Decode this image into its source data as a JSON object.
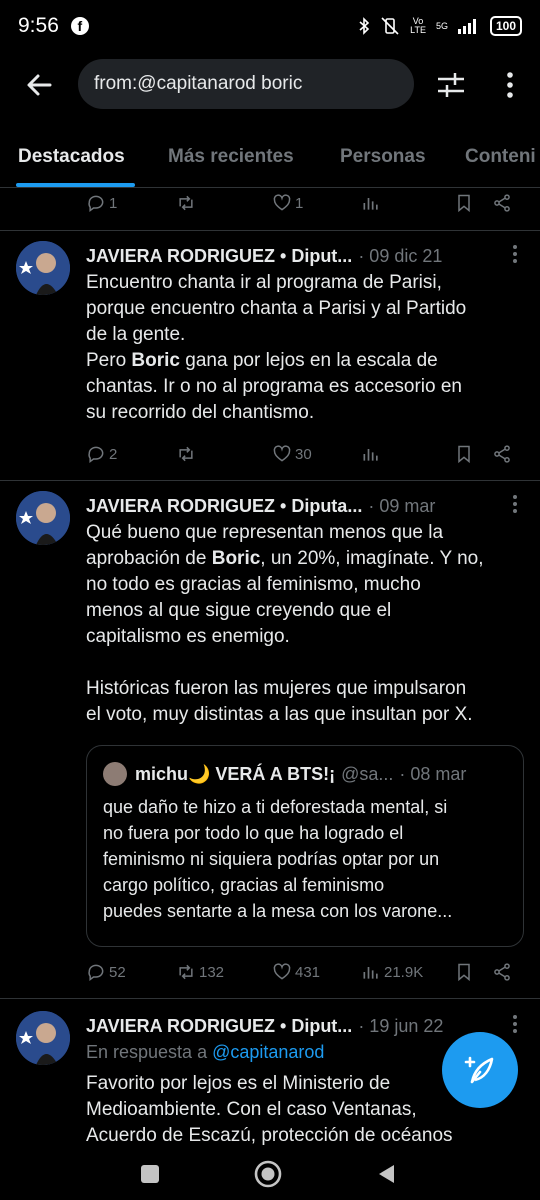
{
  "status_bar": {
    "time": "9:56",
    "network_top": "Vo",
    "network_bottom": "LTE",
    "signal_label": "5G",
    "battery": "100"
  },
  "search": {
    "query": "from:@capitanarod boric"
  },
  "tabs": [
    {
      "label": "Destacados",
      "active": true
    },
    {
      "label": "Más recientes",
      "active": false
    },
    {
      "label": "Personas",
      "active": false
    },
    {
      "label": "Conteni",
      "active": false
    }
  ],
  "top_actions": {
    "replies": "1",
    "retweets": "",
    "likes": "1"
  },
  "tweets": [
    {
      "author": "JAVIERA RODRIGUEZ • Diput...",
      "date": "· 09 dic 21",
      "body_1": "Encuentro chanta ir al programa de Parisi,\nporque encuentro chanta a Parisi y al Partido\nde la gente.\nPero ",
      "body_bold": "Boric",
      "body_2": " gana por lejos en la escala de\nchantas. Ir o no al programa es accesorio en\nsu recorrido del chantismo.",
      "replies": "2",
      "retweets": "",
      "likes": "30"
    },
    {
      "author": "JAVIERA RODRIGUEZ • Diputa...",
      "date": "· 09 mar",
      "body_1": "Qué bueno que representan menos que la\naprobación de ",
      "body_bold": "Boric",
      "body_2": ", un 20%, imagínate. Y no,\nno todo es gracias al feminismo, mucho\nmenos al que sigue creyendo que el\ncapitalismo es enemigo.\n\nHistóricas fueron las mujeres que impulsaron\nel voto, muy distintas a las que insultan por X.",
      "quote": {
        "author": "michu🌙 VERÁ A BTS!¡",
        "handle": "@sa...",
        "date": "· 08 mar",
        "body": "que daño te hizo a ti deforestada mental, si\nno fuera por todo lo que ha logrado el\nfeminismo ni siquiera podrías optar por un\ncargo político, gracias al feminismo\npuedes sentarte a la mesa con los varone..."
      },
      "replies": "52",
      "retweets": "132",
      "likes": "431",
      "views": "21.9K"
    },
    {
      "author": "JAVIERA RODRIGUEZ • Diput...",
      "date": "· 19 jun 22",
      "reply_prefix": "En respuesta a ",
      "reply_handle": "@capitanarod",
      "body_1": "Favorito por lejos es el Ministerio de\nMedioambiente. Con el caso Ventanas,\nAcuerdo de Escazú, protección de océanos"
    }
  ],
  "colors": {
    "accent": "#1d9bf0",
    "text_primary": "#e7e9ea",
    "text_secondary": "#71767b",
    "background": "#000000",
    "divider": "#2f3336"
  },
  "icons": [
    "back-arrow-icon",
    "filter-sliders-icon",
    "more-vertical-icon",
    "reply-icon",
    "retweet-icon",
    "like-icon",
    "views-icon",
    "bookmark-icon",
    "share-icon",
    "compose-icon",
    "nav-square-icon",
    "nav-home-icon",
    "nav-back-icon"
  ]
}
